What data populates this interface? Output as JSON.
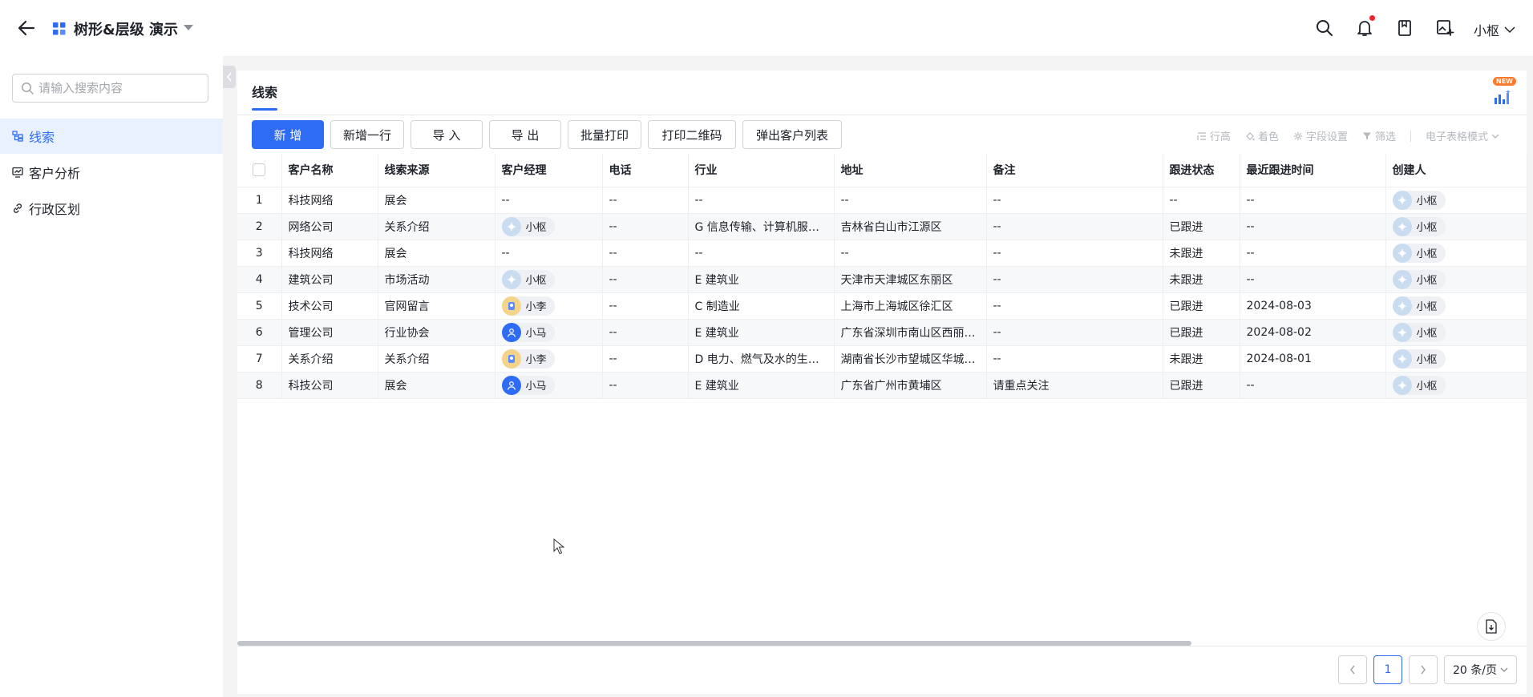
{
  "header": {
    "title": "树形&层级 演示",
    "user": "小枢"
  },
  "sidebar": {
    "search_placeholder": "请输入搜索内容",
    "items": [
      {
        "label": "线索",
        "active": true,
        "icon": "tree-icon"
      },
      {
        "label": "客户分析",
        "active": false,
        "icon": "chart-monitor-icon"
      },
      {
        "label": "行政区划",
        "active": false,
        "icon": "link-icon"
      }
    ]
  },
  "panel": {
    "tab": "线索",
    "new_badge": "NEW",
    "toolbar": {
      "add": "新 增",
      "add_row": "新增一行",
      "import": "导 入",
      "export": "导 出",
      "batch_print": "批量打印",
      "print_qr": "打印二维码",
      "popup_list": "弹出客户列表"
    },
    "tools": {
      "row_height": "行高",
      "color": "着色",
      "field_settings": "字段设置",
      "filter": "筛选",
      "mode": "电子表格模式"
    }
  },
  "table": {
    "columns": [
      "客户名称",
      "线索来源",
      "客户经理",
      "电话",
      "行业",
      "地址",
      "备注",
      "跟进状态",
      "最近跟进时间",
      "创建人"
    ],
    "rows": [
      {
        "no": "1",
        "name": "科技网络",
        "source": "展会",
        "manager": "--",
        "manager_avatar": "",
        "phone": "--",
        "industry": "--",
        "address": "--",
        "note": "--",
        "status": "--",
        "last_time": "--",
        "creator": "小枢"
      },
      {
        "no": "2",
        "name": "网络公司",
        "source": "关系介绍",
        "manager": "小枢",
        "manager_avatar": "xiaoshu",
        "phone": "--",
        "industry": "G 信息传输、计算机服务和软件业",
        "address": "吉林省白山市江源区",
        "note": "--",
        "status": "已跟进",
        "last_time": "--",
        "creator": "小枢"
      },
      {
        "no": "3",
        "name": "科技网络",
        "source": "展会",
        "manager": "--",
        "manager_avatar": "",
        "phone": "--",
        "industry": "--",
        "address": "--",
        "note": "--",
        "status": "未跟进",
        "last_time": "--",
        "creator": "小枢"
      },
      {
        "no": "4",
        "name": "建筑公司",
        "source": "市场活动",
        "manager": "小枢",
        "manager_avatar": "xiaoshu",
        "phone": "--",
        "industry": "E 建筑业",
        "address": "天津市天津城区东丽区",
        "note": "--",
        "status": "未跟进",
        "last_time": "--",
        "creator": "小枢"
      },
      {
        "no": "5",
        "name": "技术公司",
        "source": "官网留言",
        "manager": "小李",
        "manager_avatar": "xiaoli",
        "phone": "--",
        "industry": "C 制造业",
        "address": "上海市上海城区徐汇区",
        "note": "--",
        "status": "已跟进",
        "last_time": "2024-08-03",
        "creator": "小枢"
      },
      {
        "no": "6",
        "name": "管理公司",
        "source": "行业协会",
        "manager": "小马",
        "manager_avatar": "xiaoma",
        "phone": "--",
        "industry": "E 建筑业",
        "address": "广东省深圳市南山区西丽街道",
        "note": "--",
        "status": "已跟进",
        "last_time": "2024-08-02",
        "creator": "小枢"
      },
      {
        "no": "7",
        "name": "关系介绍",
        "source": "关系介绍",
        "manager": "小李",
        "manager_avatar": "xiaoli",
        "phone": "--",
        "industry": "D 电力、燃气及水的生产和供应业",
        "address": "湖南省长沙市望城区华城街道",
        "note": "--",
        "status": "未跟进",
        "last_time": "2024-08-01",
        "creator": "小枢"
      },
      {
        "no": "8",
        "name": "科技公司",
        "source": "展会",
        "manager": "小马",
        "manager_avatar": "xiaoma",
        "phone": "--",
        "industry": "E 建筑业",
        "address": "广东省广州市黄埔区",
        "note": "请重点关注",
        "status": "已跟进",
        "last_time": "--",
        "creator": "小枢"
      }
    ]
  },
  "pagination": {
    "current": "1",
    "page_size": "20 条/页"
  },
  "colors": {
    "primary": "#2f6cf6",
    "active_bg": "#eaf1fe",
    "notification_dot": "#f5222d",
    "new_badge": "#ff7a2e"
  }
}
